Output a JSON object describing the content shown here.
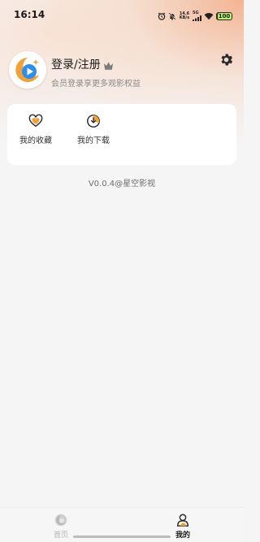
{
  "status_bar": {
    "time": "16:14",
    "net_speed_value": "14.6",
    "net_speed_unit": "KB/s",
    "network_type": "5G",
    "battery": "100"
  },
  "profile": {
    "login_title": "登录/注册",
    "member_tip": "会员登录享更多观影权益"
  },
  "quick_actions": [
    {
      "label": "我的收藏",
      "icon": "heart-icon"
    },
    {
      "label": "我的下载",
      "icon": "download-icon"
    }
  ],
  "version": "V0.0.4@星空影视",
  "bottom_nav": [
    {
      "label": "首页",
      "icon": "home-icon",
      "active": false
    },
    {
      "label": "我的",
      "icon": "user-icon",
      "active": true
    }
  ],
  "colors": {
    "accent_orange": "#f4a880",
    "logo_orange": "#f0a23a",
    "logo_blue": "#2f8fe8",
    "battery_green": "#b8f26b"
  }
}
